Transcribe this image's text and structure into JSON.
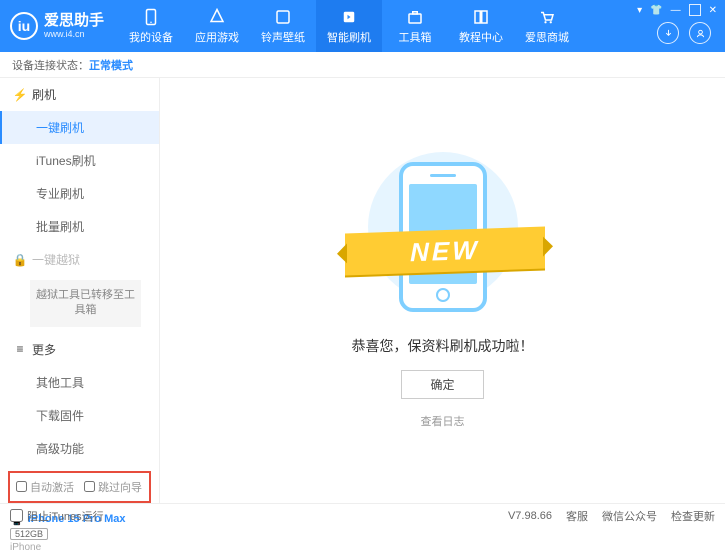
{
  "brand": {
    "name": "爱思助手",
    "url": "www.i4.cn"
  },
  "nav": {
    "items": [
      {
        "label": "我的设备"
      },
      {
        "label": "应用游戏"
      },
      {
        "label": "铃声壁纸"
      },
      {
        "label": "智能刷机"
      },
      {
        "label": "工具箱"
      },
      {
        "label": "教程中心"
      },
      {
        "label": "爱思商城"
      }
    ],
    "active_index": 3
  },
  "status": {
    "label": "设备连接状态：",
    "value": "正常模式"
  },
  "sidebar": {
    "flash_section": "刷机",
    "jailbreak_section": "一键越狱",
    "more_section": "更多",
    "flash_items": [
      "一键刷机",
      "iTunes刷机",
      "专业刷机",
      "批量刷机"
    ],
    "flash_active": 0,
    "jail_note": "越狱工具已转移至工具箱",
    "more_items": [
      "其他工具",
      "下载固件",
      "高级功能"
    ],
    "checkboxes": {
      "auto_activate": "自动激活",
      "skip_guide": "跳过向导"
    }
  },
  "device": {
    "name": "iPhone 15 Pro Max",
    "storage": "512GB",
    "type": "iPhone"
  },
  "main": {
    "ribbon": "NEW",
    "success": "恭喜您，保资料刷机成功啦！",
    "ok": "确定",
    "view_log": "查看日志"
  },
  "footer": {
    "block_itunes": "阻止iTunes运行",
    "version": "V7.98.66",
    "links": [
      "客服",
      "微信公众号",
      "检查更新"
    ]
  }
}
